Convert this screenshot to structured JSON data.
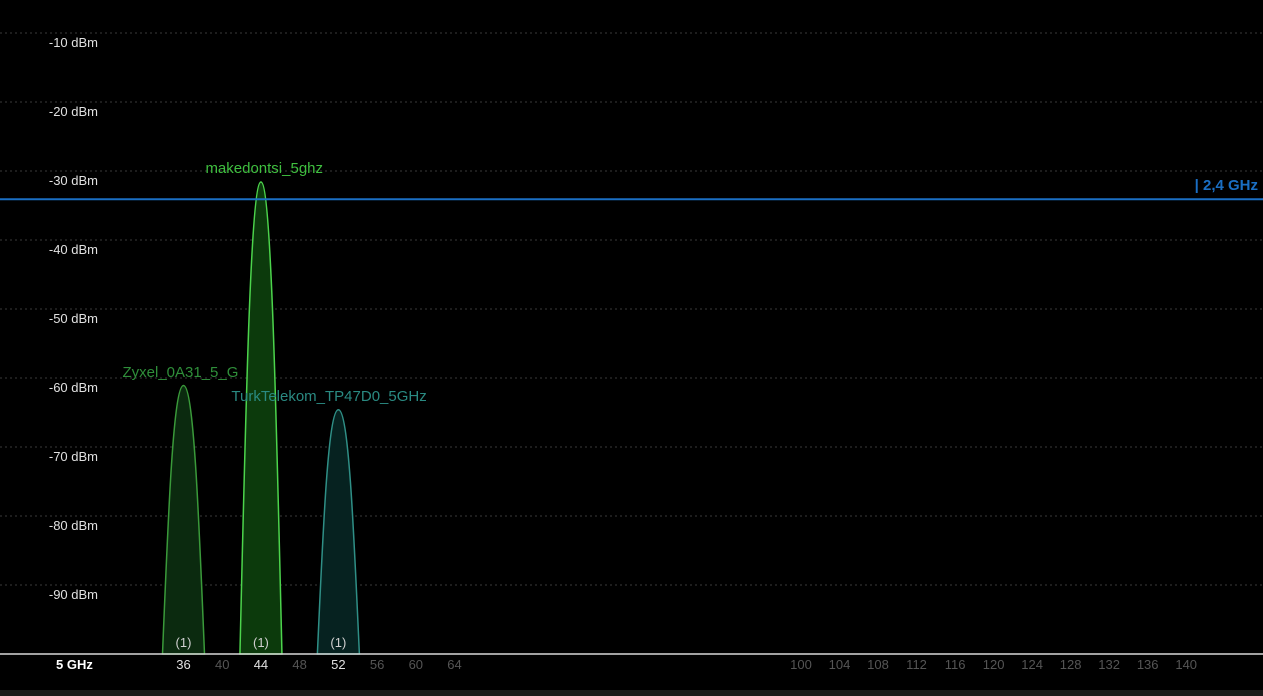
{
  "chart_data": {
    "type": "area",
    "ylim": [
      -100,
      -5
    ],
    "y_ticks": [
      "-10 dBm",
      "-20 dBm",
      "-30 dBm",
      "-40 dBm",
      "-50 dBm",
      "-60 dBm",
      "-70 dBm",
      "-80 dBm",
      "-90 dBm"
    ],
    "y_tick_values": [
      -10,
      -20,
      -30,
      -40,
      -50,
      -60,
      -70,
      -80,
      -90
    ],
    "reference_line": {
      "label": "| 2,4 GHz",
      "value": -32.5,
      "color": "#1a6fc4"
    },
    "x_axis": {
      "band_label": "5 GHz",
      "ticks": [
        {
          "label": "36",
          "channel": 36,
          "active": true
        },
        {
          "label": "40",
          "channel": 40,
          "active": false
        },
        {
          "label": "44",
          "channel": 44,
          "active": true
        },
        {
          "label": "48",
          "channel": 48,
          "active": false
        },
        {
          "label": "52",
          "channel": 52,
          "active": true
        },
        {
          "label": "56",
          "channel": 56,
          "active": false
        },
        {
          "label": "60",
          "channel": 60,
          "active": false
        },
        {
          "label": "64",
          "channel": 64,
          "active": false
        },
        {
          "label": "100",
          "channel": 100,
          "active": false
        },
        {
          "label": "104",
          "channel": 104,
          "active": false
        },
        {
          "label": "108",
          "channel": 108,
          "active": false
        },
        {
          "label": "112",
          "channel": 112,
          "active": false
        },
        {
          "label": "116",
          "channel": 116,
          "active": false
        },
        {
          "label": "120",
          "channel": 120,
          "active": false
        },
        {
          "label": "124",
          "channel": 124,
          "active": false
        },
        {
          "label": "128",
          "channel": 128,
          "active": false
        },
        {
          "label": "132",
          "channel": 132,
          "active": false
        },
        {
          "label": "136",
          "channel": 136,
          "active": false
        },
        {
          "label": "140",
          "channel": 140,
          "active": false
        }
      ]
    },
    "series": [
      {
        "name": "Zyxel_0A31_5_G",
        "channel": 36,
        "signal": -59.5,
        "count": "(1)",
        "stroke": "#3a9a3a",
        "fill": "#0b2a0f",
        "label_color": "#2f8f3a"
      },
      {
        "name": "makedontsi_5ghz",
        "channel": 44,
        "signal": -30,
        "count": "(1)",
        "stroke": "#4cd44c",
        "fill": "#0c3a0c",
        "label_color": "#3fbf3f"
      },
      {
        "name": "TurkTelekom_TP47D0_5GHz",
        "channel": 52,
        "signal": -63,
        "count": "(1)",
        "stroke": "#2f8f86",
        "fill": "#062220",
        "label_color": "#2a8a82"
      }
    ]
  }
}
